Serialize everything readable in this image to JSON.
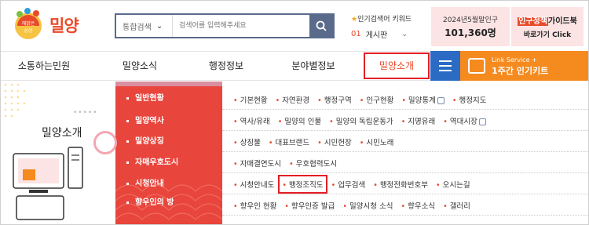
{
  "logo": {
    "badge_text": "해맑은 상상",
    "name": "밀양"
  },
  "search": {
    "scope": "통합검색",
    "placeholder": "검색어를 입력해주세요"
  },
  "popular": {
    "title": "인기검색어 키워드",
    "rank": "01",
    "keyword": "게시판"
  },
  "population": {
    "line1": "2024년5월말인구",
    "value": "101,360명"
  },
  "guide": {
    "highlight": "인구정책",
    "title_rest": "가이드북",
    "cta": "바로가기 Click"
  },
  "nav": {
    "items": [
      "소통하는민원",
      "밀양소식",
      "행정정보",
      "분야별정보",
      "밀양소개"
    ],
    "active": "밀양소개"
  },
  "link_service": {
    "small": "Link Service +",
    "title": "1주간 인기키트"
  },
  "side": {
    "title": "밀양소개",
    "dots": "•••••"
  },
  "menu": {
    "items": [
      "일반현황",
      "밀양역사",
      "밀양상징",
      "자매우호도시",
      "시청안내",
      "향우인의 방"
    ]
  },
  "rows": [
    [
      "기본현황",
      "자연환경",
      "행정구역",
      "인구현황",
      "밀양통계",
      "행정지도"
    ],
    [
      "역사/유래",
      "밀양의 인물",
      "밀양의 독립운동가",
      "지명유래",
      "역대시장"
    ],
    [
      "상징물",
      "대표브랜드",
      "시민헌장",
      "시민노래"
    ],
    [
      "자매결연도시",
      "우호협력도시"
    ],
    [
      "시청안내도",
      "행정조직도",
      "업무검색",
      "행정전화번호부",
      "오시는길"
    ],
    [
      "향우인 현황",
      "향우인증 발급",
      "밀양시청 소식",
      "향우소식",
      "갤러리"
    ]
  ],
  "selected_link": "행정조직도",
  "colors": {
    "accent": "#e94a2a",
    "menu_red": "#e8453c",
    "nav_blue": "#2b6bc4",
    "link_orange": "#f58a1f"
  }
}
